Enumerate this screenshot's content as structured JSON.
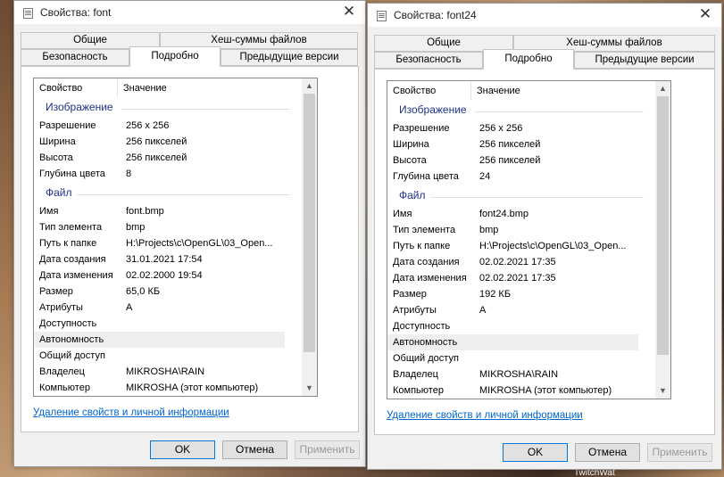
{
  "dialogs": [
    {
      "title": "Свойства: font",
      "tabs": {
        "general": "Общие",
        "hashes": "Хеш-суммы файлов",
        "security": "Безопасность",
        "details": "Подробно",
        "previous": "Предыдущие версии"
      },
      "columns": {
        "property": "Свойство",
        "value": "Значение"
      },
      "group_image": "Изображение",
      "group_file": "Файл",
      "image_rows": [
        {
          "k": "Разрешение",
          "v": "256 x 256"
        },
        {
          "k": "Ширина",
          "v": "256 пикселей"
        },
        {
          "k": "Высота",
          "v": "256 пикселей"
        },
        {
          "k": "Глубина цвета",
          "v": "8"
        }
      ],
      "file_rows": [
        {
          "k": "Имя",
          "v": "font.bmp"
        },
        {
          "k": "Тип элемента",
          "v": "bmp"
        },
        {
          "k": "Путь к папке",
          "v": "H:\\Projects\\c\\OpenGL\\03_Open..."
        },
        {
          "k": "Дата создания",
          "v": "31.01.2021 17:54"
        },
        {
          "k": "Дата изменения",
          "v": "02.02.2000 19:54"
        },
        {
          "k": "Размер",
          "v": "65,0 КБ"
        },
        {
          "k": "Атрибуты",
          "v": "A"
        },
        {
          "k": "Доступность",
          "v": ""
        },
        {
          "k": "Автономность",
          "v": ""
        },
        {
          "k": "Общий доступ",
          "v": ""
        },
        {
          "k": "Владелец",
          "v": "MIKROSHA\\RAIN"
        },
        {
          "k": "Компьютер",
          "v": "MIKROSHA (этот компьютер)"
        }
      ],
      "link": "Удаление свойств и личной информации",
      "buttons": {
        "ok": "OK",
        "cancel": "Отмена",
        "apply": "Применить"
      }
    },
    {
      "title": "Свойства: font24",
      "tabs": {
        "general": "Общие",
        "hashes": "Хеш-суммы файлов",
        "security": "Безопасность",
        "details": "Подробно",
        "previous": "Предыдущие версии"
      },
      "columns": {
        "property": "Свойство",
        "value": "Значение"
      },
      "group_image": "Изображение",
      "group_file": "Файл",
      "image_rows": [
        {
          "k": "Разрешение",
          "v": "256 x 256"
        },
        {
          "k": "Ширина",
          "v": "256 пикселей"
        },
        {
          "k": "Высота",
          "v": "256 пикселей"
        },
        {
          "k": "Глубина цвета",
          "v": "24"
        }
      ],
      "file_rows": [
        {
          "k": "Имя",
          "v": "font24.bmp"
        },
        {
          "k": "Тип элемента",
          "v": "bmp"
        },
        {
          "k": "Путь к папке",
          "v": "H:\\Projects\\c\\OpenGL\\03_Open..."
        },
        {
          "k": "Дата создания",
          "v": "02.02.2021 17:35"
        },
        {
          "k": "Дата изменения",
          "v": "02.02.2021 17:35"
        },
        {
          "k": "Размер",
          "v": "192 КБ"
        },
        {
          "k": "Атрибуты",
          "v": "A"
        },
        {
          "k": "Доступность",
          "v": ""
        },
        {
          "k": "Автономность",
          "v": ""
        },
        {
          "k": "Общий доступ",
          "v": ""
        },
        {
          "k": "Владелец",
          "v": "MIKROSHA\\RAIN"
        },
        {
          "k": "Компьютер",
          "v": "MIKROSHA (этот компьютер)"
        }
      ],
      "link": "Удаление свойств и личной информации",
      "buttons": {
        "ok": "OK",
        "cancel": "Отмена",
        "apply": "Применить"
      }
    }
  ],
  "background": {
    "corner_text": "TwitchWat"
  },
  "icons": {
    "close": "close-icon",
    "file": "file-icon",
    "scroll_up": "scroll-up-icon",
    "scroll_down": "scroll-down-icon"
  },
  "colors": {
    "group_heading": "#1e3287",
    "link": "#0066cc",
    "selected_row": "#efefef"
  }
}
